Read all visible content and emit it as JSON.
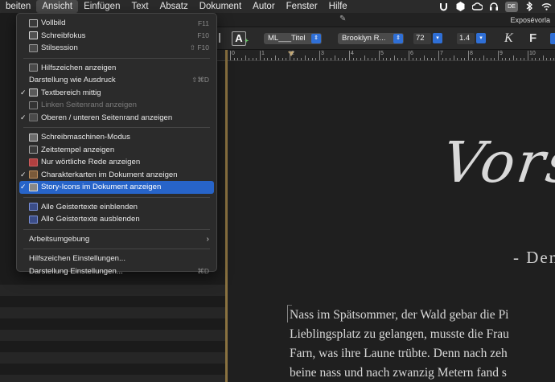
{
  "menubar": {
    "items": [
      "beiten",
      "Ansicht",
      "Einfügen",
      "Text",
      "Absatz",
      "Dokument",
      "Autor",
      "Fenster",
      "Hilfe"
    ],
    "active_index": 1,
    "status_icons": [
      "u-icon",
      "shield-icon",
      "creative-cloud-icon",
      "headset-icon",
      "keyboard-layout-icon",
      "bluetooth-icon",
      "wifi-icon"
    ],
    "keyboard_badge": "DE"
  },
  "window": {
    "title": "Exposévorla"
  },
  "toolbar": {
    "style_select": "ML___Titel",
    "font_select": "Brooklyn R...",
    "font_size": "72",
    "line_spacing": "1.4",
    "italic_label": "K",
    "bold_label": "F",
    "a_label": "A"
  },
  "ruler": {
    "labels": [
      "0",
      "1",
      "2",
      "3",
      "4",
      "5",
      "6",
      "7",
      "8",
      "9",
      "10"
    ]
  },
  "document": {
    "title": "Vorspie",
    "subtitle": "- Den",
    "lines": [
      "Nass im Spätsommer, der Wald gebar die Pi",
      "Lieblingsplatz zu gelangen, musste die Frau",
      "Farn, was ihre Laune trübte. Denn nach zeh",
      "beine nass und nach zwanzig Metern fand s"
    ]
  },
  "menu": {
    "groups": [
      [
        {
          "label": "Vollbild",
          "shortcut": "F11",
          "icon": "fullscreen-icon",
          "checked": false,
          "disabled": false
        },
        {
          "label": "Schreibfokus",
          "shortcut": "F10",
          "icon": "focus-icon",
          "checked": false,
          "disabled": false
        },
        {
          "label": "Stilsession",
          "shortcut": "⇧ F10",
          "icon": "style-session-icon",
          "checked": false,
          "disabled": false
        }
      ],
      [
        {
          "label": "Hilfszeichen anzeigen",
          "shortcut": "",
          "icon": "hidden-chars-icon",
          "checked": false,
          "disabled": false
        },
        {
          "label": "Darstellung wie Ausdruck",
          "shortcut": "⇧⌘D",
          "icon": "",
          "checked": false,
          "disabled": false
        },
        {
          "label": "Textbereich mittig",
          "shortcut": "",
          "icon": "text-center-icon",
          "checked": true,
          "disabled": false
        },
        {
          "label": "Linken Seitenrand anzeigen",
          "shortcut": "",
          "icon": "left-margin-icon",
          "checked": false,
          "disabled": true
        },
        {
          "label": "Oberen / unteren Seitenrand anzeigen",
          "shortcut": "",
          "icon": "top-bottom-margin-icon",
          "checked": true,
          "disabled": false
        }
      ],
      [
        {
          "label": "Schreibmaschinen-Modus",
          "shortcut": "",
          "icon": "typewriter-icon",
          "checked": false,
          "disabled": false
        },
        {
          "label": "Zeitstempel anzeigen",
          "shortcut": "",
          "icon": "clock-icon",
          "checked": false,
          "disabled": false
        },
        {
          "label": "Nur wörtliche Rede anzeigen",
          "shortcut": "",
          "icon": "speech-icon",
          "checked": false,
          "disabled": false
        },
        {
          "label": "Charakterkarten im Dokument anzeigen",
          "shortcut": "",
          "icon": "character-cards-icon",
          "checked": true,
          "disabled": false
        },
        {
          "label": "Story-Icons im Dokument anzeigen",
          "shortcut": "",
          "icon": "story-icons-icon",
          "checked": true,
          "disabled": false,
          "highlighted": true
        }
      ],
      [
        {
          "label": "Alle Geistertexte einblenden",
          "shortcut": "",
          "icon": "ghost-show-icon",
          "checked": false,
          "disabled": false
        },
        {
          "label": "Alle Geistertexte ausblenden",
          "shortcut": "",
          "icon": "ghost-hide-icon",
          "checked": false,
          "disabled": false
        }
      ],
      [
        {
          "label": "Arbeitsumgebung",
          "shortcut": "",
          "icon": "",
          "checked": false,
          "disabled": false,
          "submenu": true
        }
      ],
      [
        {
          "label": "Hilfszeichen Einstellungen...",
          "shortcut": "",
          "icon": "",
          "checked": false,
          "disabled": false
        },
        {
          "label": "Darstellung Einstellungen...",
          "shortcut": "⌘D",
          "icon": "",
          "checked": false,
          "disabled": false
        }
      ]
    ]
  },
  "colors": {
    "menu_highlight": "#2764C9",
    "toolbar_accent": "#2F6FD6",
    "ruler_marker": "#C8A86A",
    "page_background": "#1F1F1F"
  }
}
